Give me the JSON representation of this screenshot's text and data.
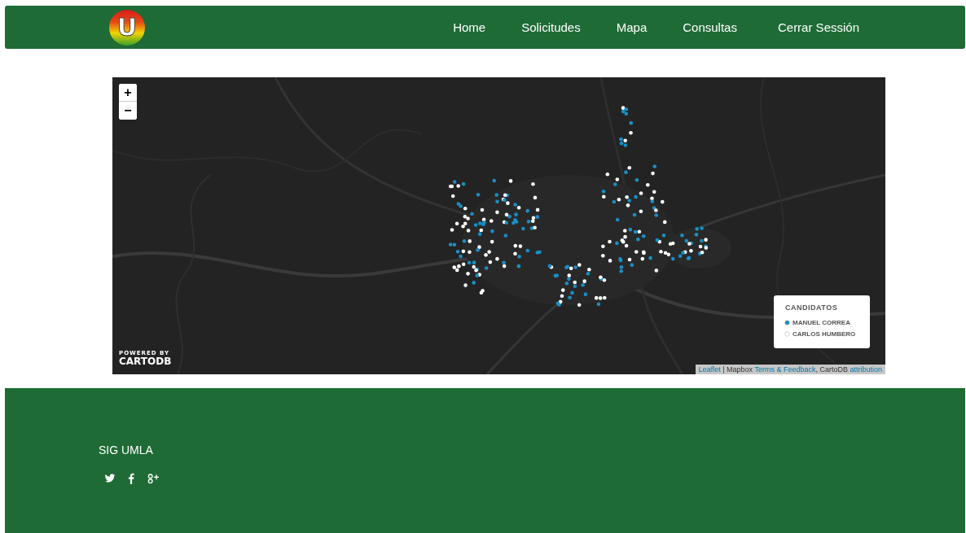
{
  "navbar": {
    "logo": "U",
    "links": [
      {
        "label": "Home"
      },
      {
        "label": "Solicitudes"
      },
      {
        "label": "Mapa"
      },
      {
        "label": "Consultas"
      },
      {
        "label": "Cerrar Sessión"
      }
    ]
  },
  "map": {
    "kind": "picture",
    "zoom": [
      "+",
      "−"
    ],
    "legend": {
      "title": "CANDIDATOS",
      "items": [
        {
          "label": "MANUEL CORREA",
          "color": "#1a8fc4"
        },
        {
          "label": "CARLOS HUMBERO",
          "color": "#ffffff"
        }
      ]
    },
    "logo": {
      "top": "POWERED BY",
      "name": "CARTODB"
    },
    "attribution": [
      {
        "text": "Leaflet",
        "kind": "link"
      },
      {
        "text": " | Mapbox ",
        "kind": "plain"
      },
      {
        "text": "Terms & Feedback",
        "kind": "link"
      },
      {
        "text": ", CartoDB ",
        "kind": "plain"
      },
      {
        "text": "attribution",
        "kind": "link"
      }
    ]
  },
  "footer": {
    "title": "SIG UMLA",
    "social": [
      {
        "kind": "twitter"
      },
      {
        "kind": "facebook"
      },
      {
        "kind": "google-plus"
      }
    ]
  }
}
